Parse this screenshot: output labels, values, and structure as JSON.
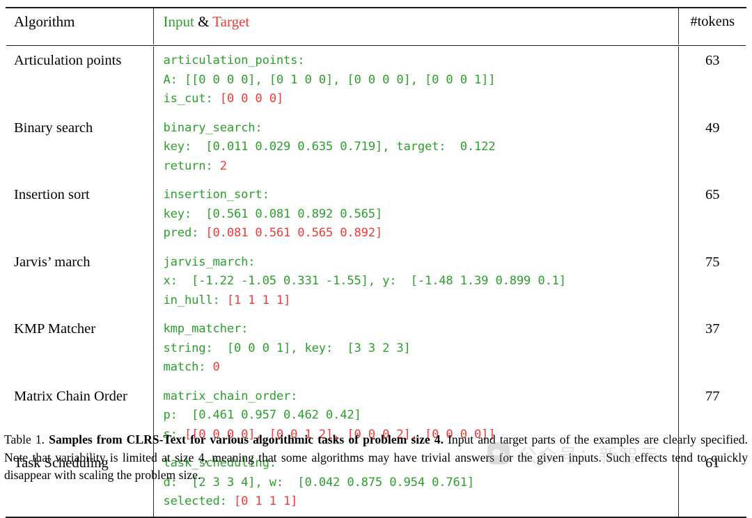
{
  "table": {
    "columns": {
      "algorithm": "Algorithm",
      "input_label": "Input",
      "amp": " & ",
      "target_label": "Target",
      "tokens": "#tokens"
    },
    "rows": [
      {
        "algorithm": "Articulation points",
        "tokens": "63",
        "lines": [
          {
            "green": "articulation_points:",
            "red": ""
          },
          {
            "green": "A: [[0 0 0 0], [0 1 0 0], [0 0 0 0], [0 0 0 1]]",
            "red": ""
          },
          {
            "green": "is_cut: ",
            "red": "[0 0 0 0]"
          }
        ]
      },
      {
        "algorithm": "Binary search",
        "tokens": "49",
        "lines": [
          {
            "green": "binary_search:",
            "red": ""
          },
          {
            "green": "key:  [0.011 0.029 0.635 0.719], target:  0.122",
            "red": ""
          },
          {
            "green": "return: ",
            "red": "2"
          }
        ]
      },
      {
        "algorithm": "Insertion sort",
        "tokens": "65",
        "lines": [
          {
            "green": "insertion_sort:",
            "red": ""
          },
          {
            "green": "key:  [0.561 0.081 0.892 0.565]",
            "red": ""
          },
          {
            "green": "pred: ",
            "red": "[0.081 0.561 0.565 0.892]"
          }
        ]
      },
      {
        "algorithm": "Jarvis’ march",
        "tokens": "75",
        "lines": [
          {
            "green": "jarvis_march:",
            "red": ""
          },
          {
            "green": "x:  [-1.22 -1.05 0.331 -1.55], y:  [-1.48 1.39 0.899 0.1]",
            "red": ""
          },
          {
            "green": "in_hull: ",
            "red": "[1 1 1 1]"
          }
        ]
      },
      {
        "algorithm": "KMP Matcher",
        "tokens": "37",
        "lines": [
          {
            "green": "kmp_matcher:",
            "red": ""
          },
          {
            "green": "string:  [0 0 0 1], key:  [3 3 2 3]",
            "red": ""
          },
          {
            "green": "match: ",
            "red": "0"
          }
        ]
      },
      {
        "algorithm": "Matrix Chain Order",
        "tokens": "77",
        "lines": [
          {
            "green": "matrix_chain_order:",
            "red": ""
          },
          {
            "green": "p:  [0.461 0.957 0.462 0.42]",
            "red": ""
          },
          {
            "green": "s: ",
            "red": "[[0 0 0 0], [0 0 1 2], [0 0 0 2], [0 0 0 0]]"
          }
        ]
      },
      {
        "algorithm": "Task Scheduling",
        "tokens": "61",
        "lines": [
          {
            "green": "task_scheduling:",
            "red": ""
          },
          {
            "green": "d:  [2 3 3 4], w:  [0.042 0.875 0.954 0.761]",
            "red": ""
          },
          {
            "green": "selected: ",
            "red": "[0 1 1 1]"
          }
        ]
      }
    ]
  },
  "caption": {
    "label": "Table 1. ",
    "bold": "Samples from CLRS-Text for various algorithmic tasks of problem size 4.",
    "rest": " Input and target parts of the examples are clearly specified. Note that variability is limited at size 4, meaning that some algorithms may have trivial answers for the given inputs. Such effects tend to quickly disappear with scaling the problem size."
  },
  "watermark": {
    "text": "公众号：新智元"
  },
  "colors": {
    "input_green": "#2ca02c",
    "target_red": "#ef3a3a",
    "rule": "#1a1a1a"
  }
}
